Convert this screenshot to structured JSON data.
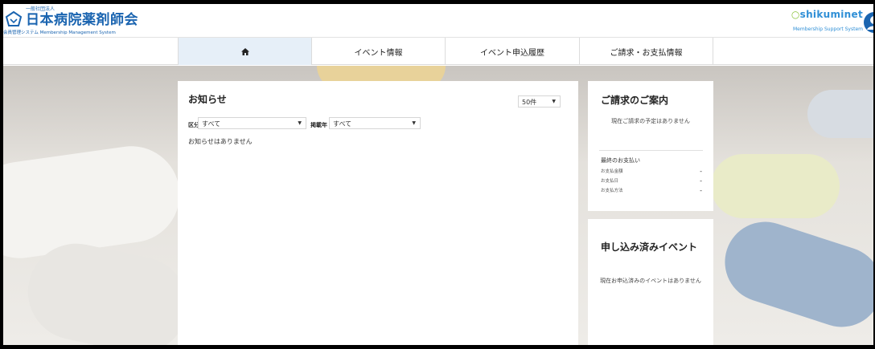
{
  "header": {
    "org_small": "一般社団法人",
    "org_name": "日本病院薬剤師会",
    "org_sub": "会員管理システム Membership Management System",
    "brand_name": "shikuminet",
    "brand_sub": "Membership Support System"
  },
  "nav": {
    "home_icon": "home-icon",
    "events": "イベント情報",
    "history": "イベント申込履歴",
    "billing": "ご請求・お支払情報"
  },
  "notice": {
    "title": "お知らせ",
    "count_value": "50件",
    "category_label": "区分",
    "category_value": "すべて",
    "year_label": "掲載年",
    "year_value": "すべて",
    "empty_message": "お知らせはありません"
  },
  "billing": {
    "title": "ご請求のご案内",
    "message": "現在ご請求の予定はありません",
    "last_payment_title": "最終のお支払い",
    "rows": [
      {
        "label": "お支払金額",
        "value": "-"
      },
      {
        "label": "お支払日",
        "value": "-"
      },
      {
        "label": "お支払方法",
        "value": "-"
      }
    ]
  },
  "applied_events": {
    "title": "申し込み済みイベント",
    "message": "現在お申込済みのイベントはありません"
  },
  "colors": {
    "brand_blue": "#1a64b0",
    "accent_blue": "#2f8fd6",
    "nav_active_bg": "#e6eff8"
  }
}
